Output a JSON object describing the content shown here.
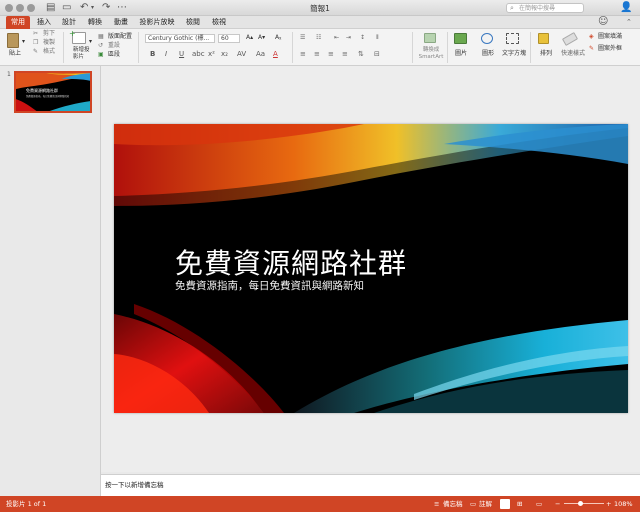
{
  "window": {
    "title": "簡報1"
  },
  "search": {
    "placeholder": "在簡報中搜尋"
  },
  "tabs": [
    {
      "label": "常用",
      "active": true
    },
    {
      "label": "插入"
    },
    {
      "label": "設計"
    },
    {
      "label": "轉換"
    },
    {
      "label": "動畫"
    },
    {
      "label": "投影片放映"
    },
    {
      "label": "檢閱"
    },
    {
      "label": "檢視"
    }
  ],
  "ribbon": {
    "paste": "貼上",
    "cut": "剪下",
    "copy": "複製",
    "format": "格式",
    "new_slide": "新增投影片",
    "layout": "版面配置",
    "reset": "重設",
    "section": "區段",
    "font_name": "Century Gothic (標...",
    "font_size": "60",
    "convert_smartart": "轉換成 SmartArt",
    "picture": "圖片",
    "shape": "圖形",
    "textbox": "文字方塊",
    "arrange": "排列",
    "quick_styles": "快速樣式",
    "shape_fill": "圖案填滿",
    "shape_outline": "圖案外框"
  },
  "slides_panel": {
    "slide_number": "1",
    "thumb_title": "免費資源網路社群",
    "thumb_subtitle": "免費資源指南，每日免費資訊與網路新知"
  },
  "slide": {
    "title": "免費資源網路社群",
    "subtitle": "免費資源指南，每日免費資訊與網路新知"
  },
  "notes": {
    "placeholder": "按一下以新增備忘稿"
  },
  "status": {
    "slide_of": "投影片 1 of 1",
    "notes_button": "備忘稿",
    "comments_button": "註解",
    "zoom": "108%"
  },
  "colors": {
    "accent": "#d04525"
  }
}
